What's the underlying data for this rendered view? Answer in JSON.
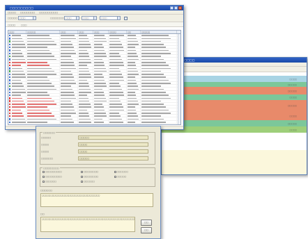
{
  "list_window": {
    "title": "□□□□□□□□□",
    "menu": [
      "□□□□",
      "□□□□□□□",
      "□□□□□□□□□"
    ],
    "toolbar": {
      "field1_label": "□□□□□",
      "field1_value": "□□□",
      "field2_label": "□□□□□□□",
      "field2_value": "□□□",
      "field3_value": "□□□",
      "field4_value": "□□□"
    },
    "subbar": [
      "□□□□",
      "□□□"
    ],
    "columns": [
      "□□□",
      "□□□□□",
      "□□□",
      "□□□",
      "□□□",
      "□□□□",
      "□□",
      "□□□□□"
    ]
  },
  "form_window": {
    "group1_title": "□□□□□□",
    "fields": [
      {
        "label": "□□□□□",
        "value": "□□□□□"
      },
      {
        "label": "□□□□",
        "value": "□□□□"
      },
      {
        "label": "□□□□",
        "value": "□□□□"
      },
      {
        "label": "□□□□□□",
        "value": "□□□□□"
      }
    ],
    "group2_title": "□□□□□□□□",
    "checkboxes": [
      "□□□□□□□□□",
      "□□□□□□□□",
      "□□□□□□",
      "□□□□□□□□□",
      "□□□□□□□□",
      "□□□□□",
      "□□□□□□",
      "□□□□□□"
    ],
    "memo1_title": "□□□□□□",
    "memo1_text": "□□□□□□□□□□□□□□□□□□□□□□□□□□□□□□□□□□",
    "memo2_title": "□□",
    "memo2_text": "□□□□□□□□□□□□□□□□□□□□□□□□□□□□□□□□□□□□□□□□□□□□□□□□□□□□□□□□□□",
    "ok_label": "□□",
    "cancel_label": "□□"
  },
  "timeline_window": {
    "title": "□□□□□□□□□□□",
    "bands": [
      {
        "color": "#a8d4e4",
        "value": "□□□□"
      },
      {
        "color": "#7cc79a",
        "value": "□□□□□"
      },
      {
        "color": "#e88a6a",
        "value": "□□□□□"
      },
      {
        "color": "#7cc79a",
        "value": "□□□□"
      },
      {
        "color": "#e88a6a",
        "value": "□□□□□"
      },
      {
        "color": "#e88a6a",
        "value": "□□□□"
      },
      {
        "color": "#7cc79a",
        "value": "□□□□□"
      },
      {
        "color": "#9ecf7a",
        "value": "□□□□"
      }
    ]
  }
}
